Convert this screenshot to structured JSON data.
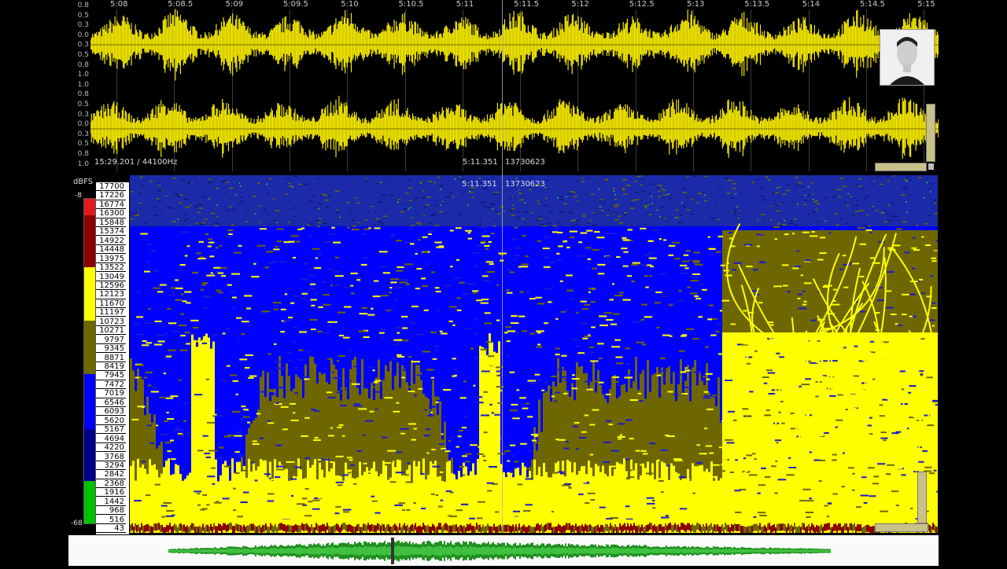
{
  "waveform": {
    "axis_labels": [
      "0.8",
      "0.5",
      "0.3",
      "0.0",
      "0.3",
      "0.5",
      "0.8",
      "1.0",
      "1.0",
      "0.8",
      "0.5",
      "0.3",
      "0.0",
      "0.3",
      "0.5",
      "0.8",
      "1.0"
    ],
    "time_ticks": [
      "5:08",
      "5:08.5",
      "5:09",
      "5:09.5",
      "5:10",
      "5:10.5",
      "5:11",
      "5:11.5",
      "5:12",
      "5:12.5",
      "5:13",
      "5:13.5",
      "5:14",
      "5:14.5",
      "5:15"
    ],
    "info_left": "15:29.201 / 44100Hz",
    "cursor_time": "5:11.351",
    "cursor_sample": "13730623",
    "color": "#f2e600"
  },
  "spectrogram": {
    "unit_label": "dBFS",
    "db_top": "-8",
    "db_bottom": "-68",
    "cursor_time": "5:11.351",
    "cursor_sample": "13730623",
    "frequencies": [
      "17700",
      "17226",
      "16774",
      "16300",
      "15848",
      "15374",
      "14922",
      "14448",
      "13975",
      "13522",
      "13049",
      "12596",
      "12123",
      "11670",
      "11197",
      "10723",
      "10271",
      "9797",
      "9345",
      "8871",
      "8419",
      "7945",
      "7472",
      "7019",
      "6546",
      "6093",
      "5620",
      "5167",
      "4694",
      "4220",
      "3768",
      "3294",
      "2842",
      "2368",
      "1916",
      "1442",
      "968",
      "516",
      "43"
    ],
    "palette": [
      "#e11b1b",
      "#8b0000",
      "#ffff00",
      "#6e6700",
      "#0000ff",
      "#00008b",
      "#00c000"
    ]
  },
  "overview": {
    "wave_color": "#1f8f1f"
  }
}
